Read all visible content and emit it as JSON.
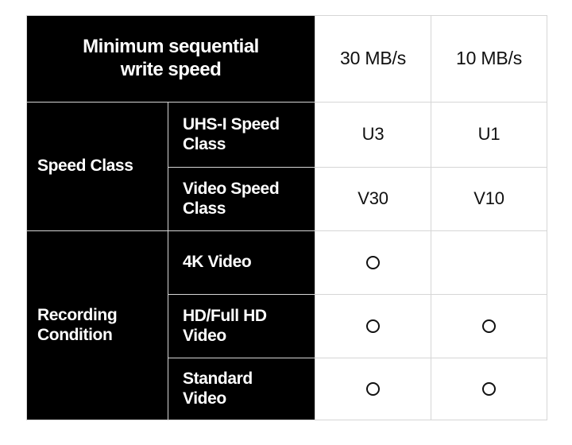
{
  "table": {
    "header": {
      "row_label": "Minimum sequential\nwrite speed",
      "row_label_line1": "Minimum sequential",
      "row_label_line2": "write speed",
      "values": [
        "30 MB/s",
        "10 MB/s"
      ]
    },
    "sections": [
      {
        "group_label": "Speed Class",
        "rows": [
          {
            "label_line1": "UHS-I Speed",
            "label_line2": "Class",
            "values": [
              "U3",
              "U1"
            ]
          },
          {
            "label_line1": "Video Speed",
            "label_line2": "Class",
            "values": [
              "V30",
              "V10"
            ]
          }
        ]
      },
      {
        "group_label_line1": "Recording",
        "group_label_line2": "Condition",
        "rows": [
          {
            "label_line1": "4K Video",
            "label_line2": "",
            "marks": [
              "circle",
              "none"
            ]
          },
          {
            "label_line1": "HD/Full HD",
            "label_line2": "Video",
            "marks": [
              "circle",
              "circle"
            ]
          },
          {
            "label_line1": "Standard",
            "label_line2": "Video",
            "marks": [
              "circle",
              "circle"
            ]
          }
        ]
      }
    ],
    "colors": {
      "label_background": "#000000",
      "label_text": "#ffffff",
      "value_background": "#ffffff",
      "value_text": "#101010",
      "grid_line": "#d6d6d6",
      "mark_stroke": "#111111"
    }
  }
}
